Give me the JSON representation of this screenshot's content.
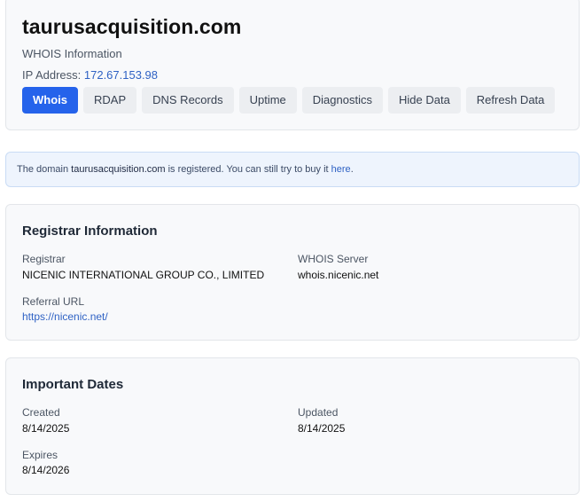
{
  "header": {
    "domain": "taurusacquisition.com",
    "subtitle": "WHOIS Information",
    "ip_label": "IP Address:",
    "ip_value": "172.67.153.98",
    "tabs": [
      {
        "label": "Whois",
        "active": true
      },
      {
        "label": "RDAP"
      },
      {
        "label": "DNS Records"
      },
      {
        "label": "Uptime"
      },
      {
        "label": "Diagnostics"
      },
      {
        "label": "Hide Data"
      },
      {
        "label": "Refresh Data"
      }
    ]
  },
  "notice": {
    "prefix": "The domain",
    "domain": "taurusacquisition.com",
    "middle": "is registered. You can still try to buy it",
    "link": "here",
    "suffix": "."
  },
  "registrar": {
    "title": "Registrar Information",
    "registrar_label": "Registrar",
    "registrar_value": "NICENIC INTERNATIONAL GROUP CO., LIMITED",
    "whois_label": "WHOIS Server",
    "whois_value": "whois.nicenic.net",
    "referral_label": "Referral URL",
    "referral_value": "https://nicenic.net/"
  },
  "dates": {
    "title": "Important Dates",
    "created_label": "Created",
    "created_value": "8/14/2025",
    "updated_label": "Updated",
    "updated_value": "8/14/2025",
    "expires_label": "Expires",
    "expires_value": "8/14/2026"
  },
  "colors": {
    "accent": "#2563eb",
    "link": "#2f62c4",
    "card_bg": "#f8f9fb",
    "notice_bg": "#eef4fd"
  }
}
